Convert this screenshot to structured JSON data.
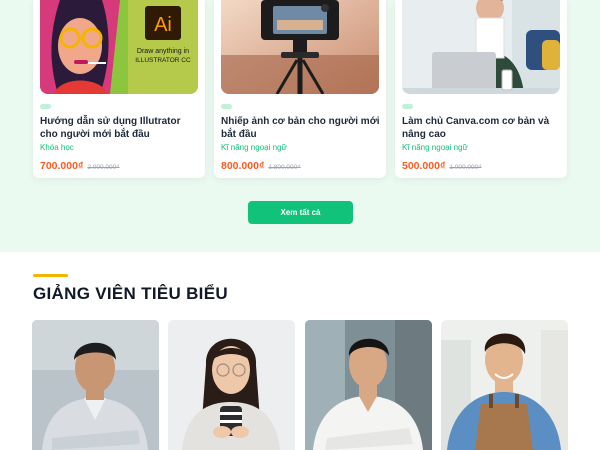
{
  "courses": [
    {
      "thumb_text_logo": "Ai",
      "thumb_text_line1": "Draw anything in",
      "thumb_text_line2": "ILLUSTRATOR CC",
      "title": "Hướng dẫn sử dụng Illutrator cho người mới bắt đầu",
      "category": "Khóa học",
      "price": "700.000₫",
      "old_price": "2.000.000₫"
    },
    {
      "title": "Nhiếp ảnh cơ bản cho người mới bắt đầu",
      "category": "Kĩ năng ngoại ngữ",
      "price": "800.000₫",
      "old_price": "1.800.000₫"
    },
    {
      "title": "Làm chủ Canva.com cơ bản và nâng cao",
      "category": "Kĩ năng ngoại ngữ",
      "price": "500.000₫",
      "old_price": "1.000.000₫"
    }
  ],
  "see_all_label": "Xem tất cả",
  "section": {
    "title": "GIẢNG VIÊN TIÊU BIỂU"
  },
  "colors": {
    "accent": "#10c27a",
    "price": "#ff5a1f",
    "section_bar": "#f5b400",
    "band": "#eafaf1"
  }
}
